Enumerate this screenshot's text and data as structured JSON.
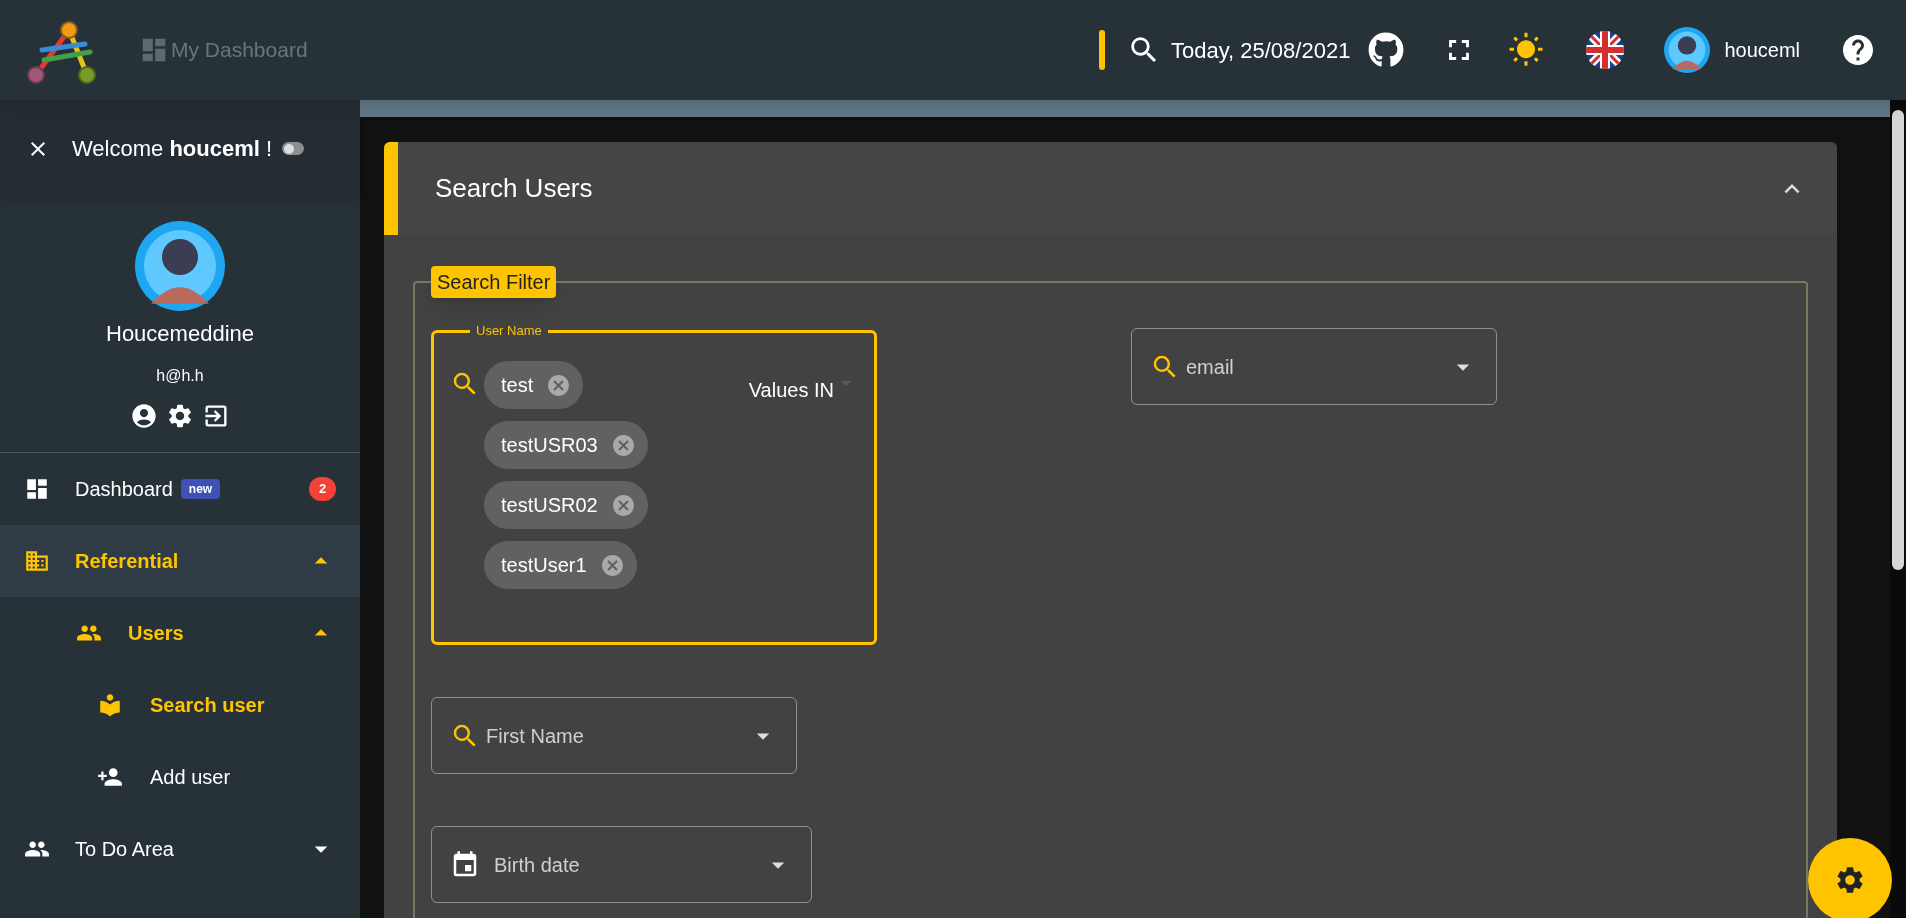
{
  "header": {
    "title": "My Dashboard",
    "date": "Today, 25/08/2021",
    "user": "houceml"
  },
  "sidebar": {
    "welcome": {
      "text": "Welcome **houceml** !",
      "toggle_on": false
    },
    "profile": {
      "name": "Houcemeddine",
      "email": "h@h.h"
    },
    "menu": [
      {
        "label": "Dashboard",
        "kind": "dashboard",
        "tag": "new",
        "count": "2",
        "selected": false
      },
      {
        "label": "Referential",
        "kind": "building",
        "selected": true,
        "expanded": true,
        "children": [
          {
            "label": "Users",
            "kind": "people",
            "selected": true,
            "expanded": true,
            "children": [
              {
                "label": "Search user",
                "kind": "reader",
                "selected": true
              },
              {
                "label": "Add user",
                "kind": "add-person",
                "selected": false
              }
            ]
          }
        ]
      },
      {
        "label": "To Do Area",
        "kind": "people",
        "selected": false,
        "expanded": false
      }
    ]
  },
  "card": {
    "title": "Search Users",
    "expanded": true,
    "legend": "Search Filter",
    "fields": [
      {
        "kind": "chips",
        "label": "User Name",
        "focused": true,
        "chips": [
          "test",
          "testUSR03",
          "testUSR02",
          "testUser1"
        ],
        "operator": "Values IN"
      },
      {
        "kind": "select",
        "placeholder": "email"
      },
      {
        "kind": "select",
        "placeholder": "First Name"
      },
      {
        "kind": "date",
        "placeholder": "Birth date"
      }
    ]
  }
}
